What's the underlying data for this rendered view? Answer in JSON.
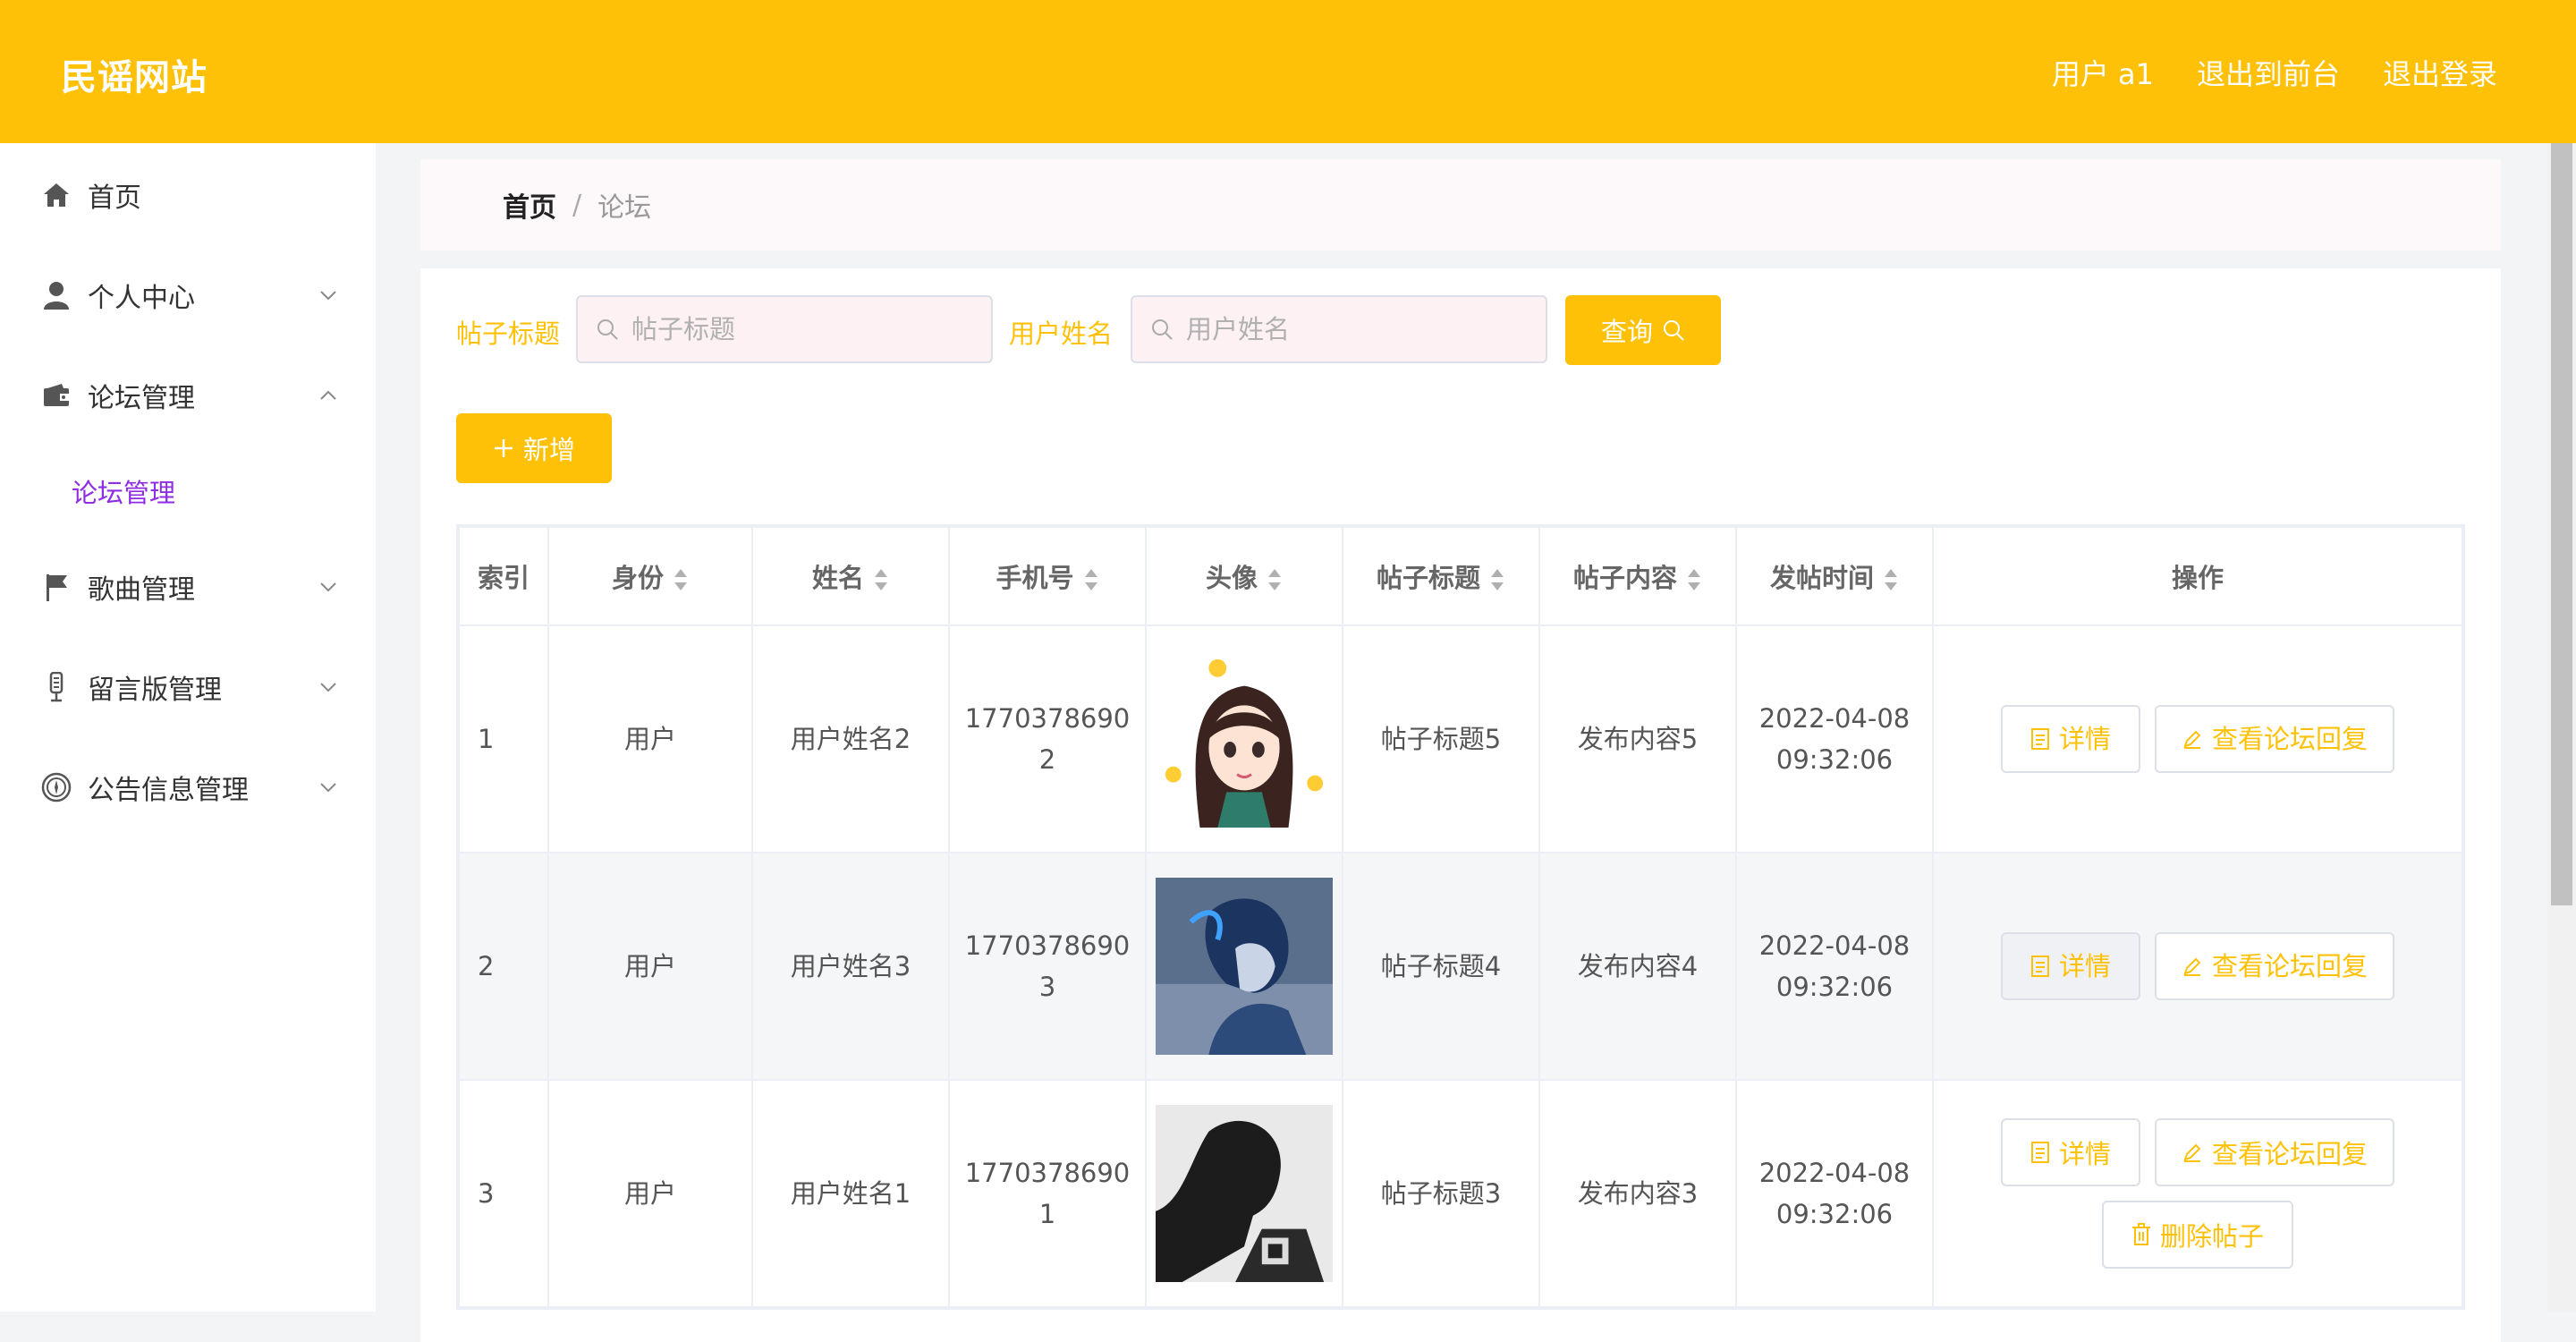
{
  "header": {
    "title": "民谣网站",
    "user": "用户 a1",
    "exit_front": "退出到前台",
    "logout": "退出登录"
  },
  "sidebar": {
    "items": [
      {
        "label": "首页",
        "icon": "home-icon",
        "expanded": null
      },
      {
        "label": "个人中心",
        "icon": "user-icon",
        "expanded": false
      },
      {
        "label": "论坛管理",
        "icon": "wallet-icon",
        "expanded": true
      },
      {
        "label": "歌曲管理",
        "icon": "flag-icon",
        "expanded": false
      },
      {
        "label": "留言版管理",
        "icon": "microphone-icon",
        "expanded": false
      },
      {
        "label": "公告信息管理",
        "icon": "compass-icon",
        "expanded": false
      }
    ],
    "active_subitem": "论坛管理"
  },
  "breadcrumb": {
    "home": "首页",
    "separator": "/",
    "current": "论坛"
  },
  "search": {
    "title_label": "帖子标题",
    "title_placeholder": "帖子标题",
    "name_label": "用户姓名",
    "name_placeholder": "用户姓名",
    "query_button": "查询",
    "add_button": "新增"
  },
  "table": {
    "headers": [
      "索引",
      "身份",
      "姓名",
      "手机号",
      "头像",
      "帖子标题",
      "帖子内容",
      "发帖时间",
      "操作"
    ],
    "rows": [
      {
        "index": "1",
        "identity": "用户",
        "name": "用户姓名2",
        "phone_a": "1770378690",
        "phone_b": "2",
        "avatar": "cartoon-girl-avatar",
        "post_title": "帖子标题5",
        "post_content": "发布内容5",
        "date": "2022-04-08",
        "time": "09:32:06"
      },
      {
        "index": "2",
        "identity": "用户",
        "name": "用户姓名3",
        "phone_a": "1770378690",
        "phone_b": "3",
        "avatar": "anime-boy-avatar",
        "post_title": "帖子标题4",
        "post_content": "发布内容4",
        "date": "2022-04-08",
        "time": "09:32:06"
      },
      {
        "index": "3",
        "identity": "用户",
        "name": "用户姓名1",
        "phone_a": "1770378690",
        "phone_b": "1",
        "avatar": "silhouette-man-avatar",
        "post_title": "帖子标题3",
        "post_content": "发布内容3",
        "date": "2022-04-08",
        "time": "09:32:06"
      }
    ],
    "actions": {
      "detail": "详情",
      "view_replies": "查看论坛回复",
      "delete": "删除帖子"
    }
  },
  "colors": {
    "accent": "#ffc107",
    "submenu_active": "#8e2de2"
  }
}
